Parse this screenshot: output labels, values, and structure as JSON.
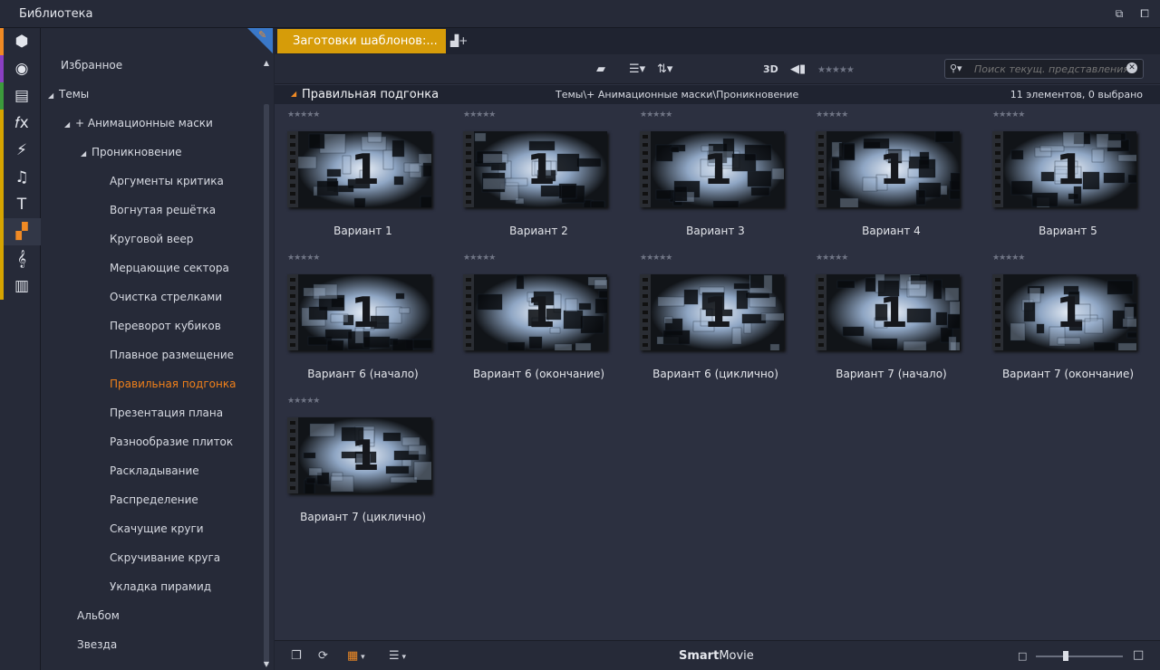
{
  "window": {
    "title": "Библиотека"
  },
  "iconbar": [
    {
      "name": "box-icon",
      "glyph": "⬢",
      "color": "#f08a24"
    },
    {
      "name": "film-reel-icon",
      "glyph": "◉",
      "color": "#8a3fc2"
    },
    {
      "name": "media-stack-icon",
      "glyph": "▤",
      "color": "#3c9a3c"
    },
    {
      "name": "fx-icon",
      "glyph": "𝑓x",
      "color": "#d6a400"
    },
    {
      "name": "lightning-icon",
      "glyph": "⚡",
      "color": "#d6a400"
    },
    {
      "name": "music-note-icon",
      "glyph": "♫",
      "color": "#d6a400"
    },
    {
      "name": "text-icon",
      "glyph": "T",
      "color": "#d6a400"
    },
    {
      "name": "templates-icon",
      "glyph": "▞",
      "color": "#d6a400"
    },
    {
      "name": "treble-clef-icon",
      "glyph": "𝄞",
      "color": "#d6a400"
    },
    {
      "name": "piano-icon",
      "glyph": "▥",
      "color": "#d6a400"
    }
  ],
  "tree": {
    "favorites": "Избранное",
    "themes": "Темы",
    "anim_masks": "+ Анимационные маски",
    "penetration": "Проникновение",
    "items": [
      "Аргументы критика",
      "Вогнутая решётка",
      "Круговой веер",
      "Мерцающие сектора",
      "Очистка стрелками",
      "Переворот кубиков",
      "Плавное размещение",
      "Правильная подгонка",
      "Презентация плана",
      "Разнообразие плиток",
      "Раскладывание",
      "Распределение",
      "Скачущие круги",
      "Скручивание круга",
      "Укладка пирамид"
    ],
    "selected_index": 7,
    "album": "Альбом",
    "star": "Звезда"
  },
  "tab": {
    "label": "Заготовки шаблонов:..."
  },
  "toolbar": {
    "label_3d": "3D",
    "search_placeholder": "Поиск текущ. представления"
  },
  "pathbar": {
    "title": "Правильная подгонка",
    "path": "Темы\\+ Анимационные маски\\Проникновение",
    "count": "11 элементов, 0 выбрано"
  },
  "items": [
    "Вариант 1",
    "Вариант 2",
    "Вариант 3",
    "Вариант 4",
    "Вариант 5",
    "Вариант 6 (начало)",
    "Вариант 6 (окончание)",
    "Вариант 6 (циклично)",
    "Вариант 7 (начало)",
    "Вариант 7 (окончание)",
    "Вариант 7 (циклично)"
  ],
  "bottombar": {
    "brand_bold": "Smart",
    "brand_rest": "Movie"
  },
  "colors": {
    "accent_orange": "#f08a24",
    "tab_gold": "#d69c09"
  }
}
